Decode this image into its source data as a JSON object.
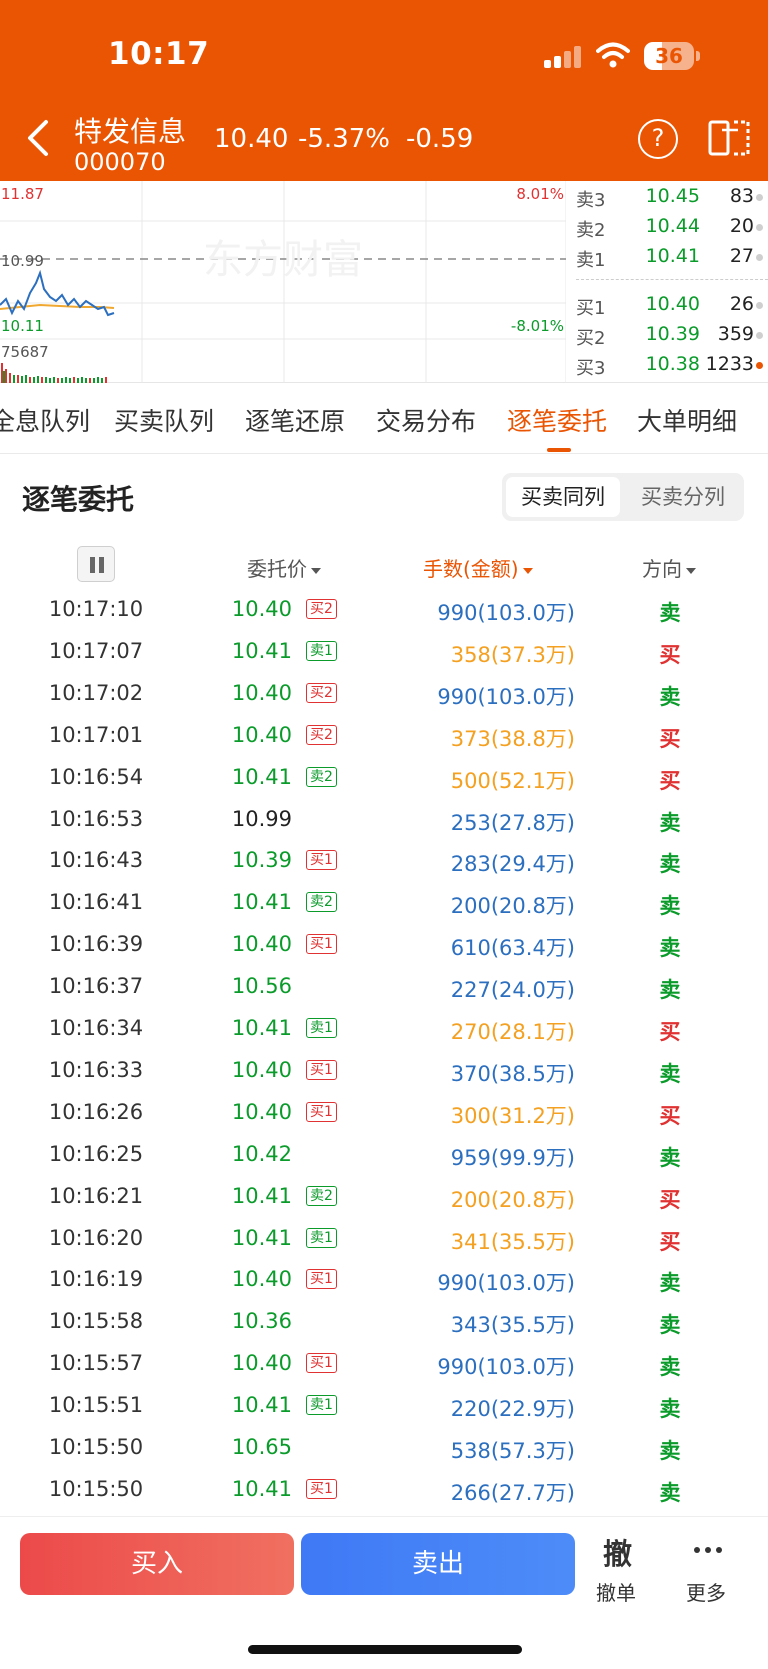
{
  "status": {
    "time": "10:17",
    "battery": "36",
    "battery_level": 0.36
  },
  "stock": {
    "name": "特发信息",
    "code": "000070",
    "price": "10.40",
    "pct": "-5.37%",
    "change": "-0.59"
  },
  "chart": {
    "high_label": "11.87",
    "prev_close_label": "10.99",
    "low_label": "10.11",
    "volume_label": "75687",
    "pct_up_label": "8.01%",
    "pct_down_label": "-8.01%",
    "watermark": "东方财富"
  },
  "order_book": {
    "asks": [
      {
        "label": "卖3",
        "price": "10.45",
        "volume": "83"
      },
      {
        "label": "卖2",
        "price": "10.44",
        "volume": "20"
      },
      {
        "label": "卖1",
        "price": "10.41",
        "volume": "27"
      }
    ],
    "bids": [
      {
        "label": "买1",
        "price": "10.40",
        "volume": "26"
      },
      {
        "label": "买2",
        "price": "10.39",
        "volume": "359"
      },
      {
        "label": "买3",
        "price": "10.38",
        "volume": "1233"
      }
    ]
  },
  "tabs": [
    {
      "label": "全息队列"
    },
    {
      "label": "买卖队列"
    },
    {
      "label": "逐笔还原"
    },
    {
      "label": "交易分布"
    },
    {
      "label": "逐笔委托"
    },
    {
      "label": "大单明细"
    }
  ],
  "section": {
    "title": "逐笔委托",
    "seg_same": "买卖同列",
    "seg_split": "买卖分列"
  },
  "columns": {
    "price": "委托价",
    "volume": "手数(金额)",
    "direction": "方向"
  },
  "trades": [
    {
      "time": "10:17:10",
      "price": "10.40",
      "badge": "买2",
      "volume": "990(103.0万)",
      "direction": "卖"
    },
    {
      "time": "10:17:07",
      "price": "10.41",
      "badge": "卖1",
      "volume": "358(37.3万)",
      "direction": "买"
    },
    {
      "time": "10:17:02",
      "price": "10.40",
      "badge": "买2",
      "volume": "990(103.0万)",
      "direction": "卖"
    },
    {
      "time": "10:17:01",
      "price": "10.40",
      "badge": "买2",
      "volume": "373(38.8万)",
      "direction": "买"
    },
    {
      "time": "10:16:54",
      "price": "10.41",
      "badge": "卖2",
      "volume": "500(52.1万)",
      "direction": "买"
    },
    {
      "time": "10:16:53",
      "price": "10.99",
      "badge": "",
      "volume": "253(27.8万)",
      "direction": "卖"
    },
    {
      "time": "10:16:43",
      "price": "10.39",
      "badge": "买1",
      "volume": "283(29.4万)",
      "direction": "卖"
    },
    {
      "time": "10:16:41",
      "price": "10.41",
      "badge": "卖2",
      "volume": "200(20.8万)",
      "direction": "卖"
    },
    {
      "time": "10:16:39",
      "price": "10.40",
      "badge": "买1",
      "volume": "610(63.4万)",
      "direction": "卖"
    },
    {
      "time": "10:16:37",
      "price": "10.56",
      "badge": "",
      "volume": "227(24.0万)",
      "direction": "卖"
    },
    {
      "time": "10:16:34",
      "price": "10.41",
      "badge": "卖1",
      "volume": "270(28.1万)",
      "direction": "买"
    },
    {
      "time": "10:16:33",
      "price": "10.40",
      "badge": "买1",
      "volume": "370(38.5万)",
      "direction": "卖"
    },
    {
      "time": "10:16:26",
      "price": "10.40",
      "badge": "买1",
      "volume": "300(31.2万)",
      "direction": "买"
    },
    {
      "time": "10:16:25",
      "price": "10.42",
      "badge": "",
      "volume": "959(99.9万)",
      "direction": "卖"
    },
    {
      "time": "10:16:21",
      "price": "10.41",
      "badge": "卖2",
      "volume": "200(20.8万)",
      "direction": "买"
    },
    {
      "time": "10:16:20",
      "price": "10.41",
      "badge": "卖1",
      "volume": "341(35.5万)",
      "direction": "买"
    },
    {
      "time": "10:16:19",
      "price": "10.40",
      "badge": "买1",
      "volume": "990(103.0万)",
      "direction": "卖"
    },
    {
      "time": "10:15:58",
      "price": "10.36",
      "badge": "",
      "volume": "343(35.5万)",
      "direction": "卖"
    },
    {
      "time": "10:15:57",
      "price": "10.40",
      "badge": "买1",
      "volume": "990(103.0万)",
      "direction": "卖"
    },
    {
      "time": "10:15:51",
      "price": "10.41",
      "badge": "卖1",
      "volume": "220(22.9万)",
      "direction": "卖"
    },
    {
      "time": "10:15:50",
      "price": "10.65",
      "badge": "",
      "volume": "538(57.3万)",
      "direction": "卖"
    },
    {
      "time": "10:15:50",
      "price": "10.41",
      "badge": "买1",
      "volume": "266(27.7万)",
      "direction": "卖"
    }
  ],
  "bottom": {
    "buy": "买入",
    "sell": "卖出",
    "cancel_icon": "撤",
    "cancel": "撤单",
    "more": "更多"
  },
  "colors": {
    "brand": "#ea5504",
    "up": "#e03232",
    "down": "#0b9b2b",
    "blue": "#2c6fbf",
    "orange": "#f4a020"
  }
}
